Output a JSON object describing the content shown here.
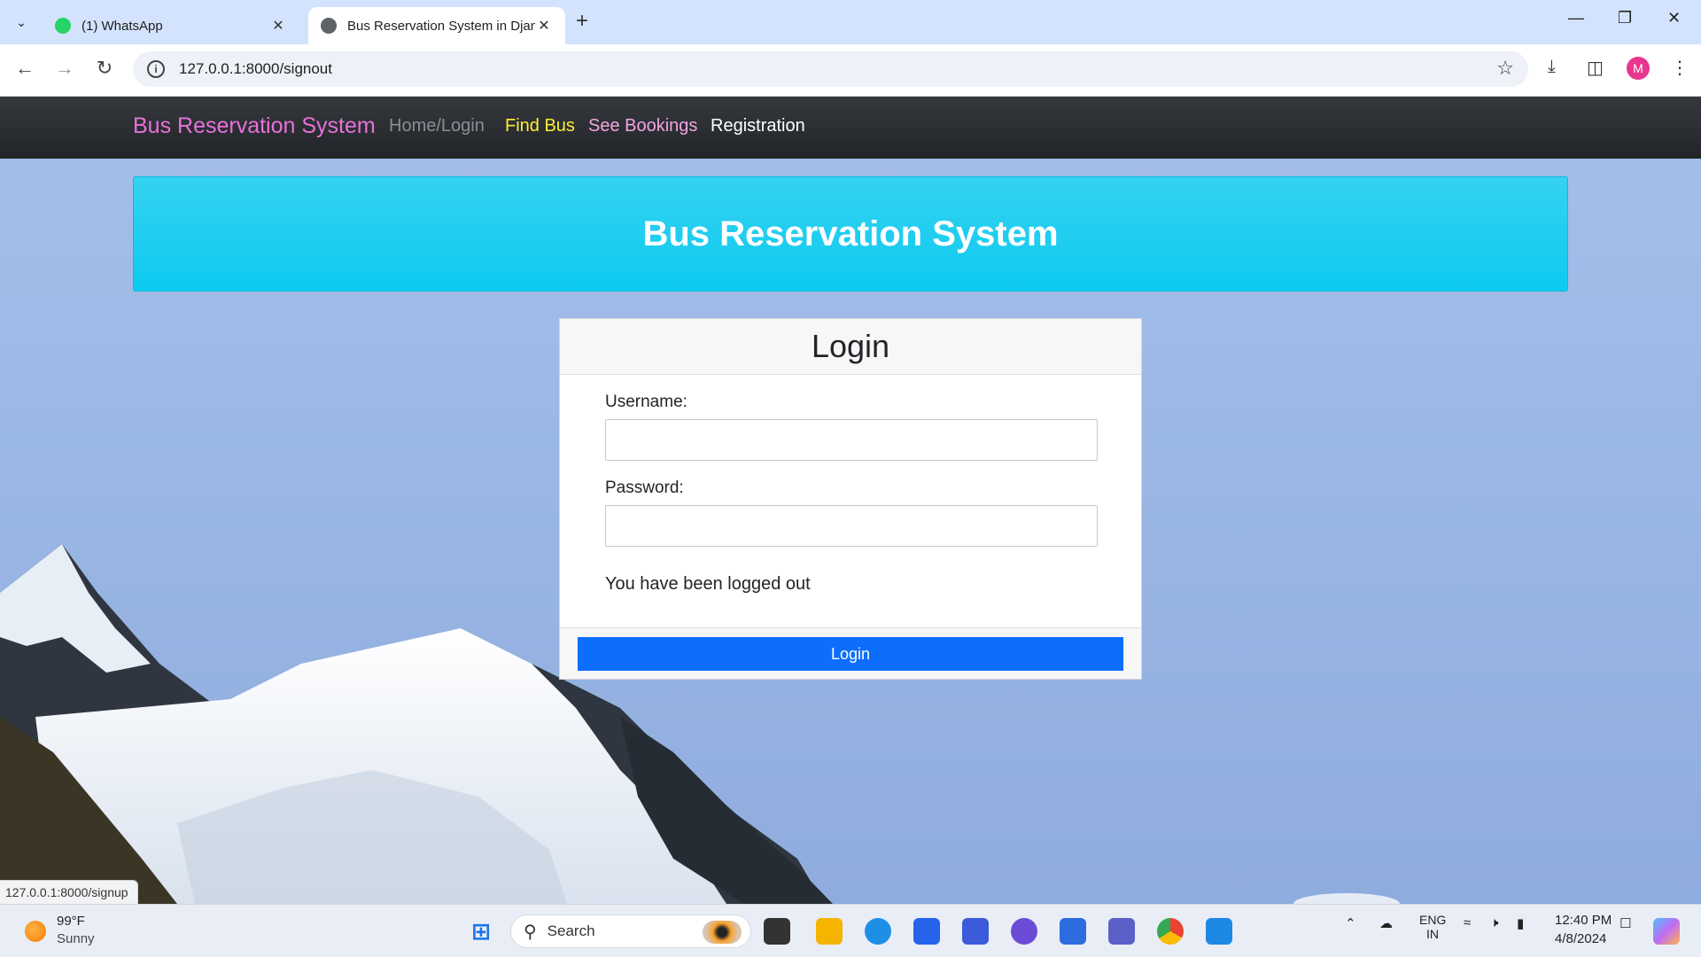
{
  "browser": {
    "tabs": [
      {
        "label": "(1) WhatsApp",
        "active": false
      },
      {
        "label": "Bus Reservation System in Djan",
        "active": true
      }
    ],
    "url": "127.0.0.1:8000/signout",
    "profile_initial": "M",
    "status_url": "127.0.0.1:8000/signup"
  },
  "navbar": {
    "brand": "Bus Reservation System",
    "links": [
      {
        "label": "Home/Login",
        "color": "#8a8f95"
      },
      {
        "label": "Find Bus",
        "color": "#ffee33"
      },
      {
        "label": "See Bookings",
        "color": "#f2a5e2"
      },
      {
        "label": "Registration",
        "color": "#ffffff"
      }
    ],
    "brand_color": "#e871d9"
  },
  "hero": {
    "title": "Bus Reservation System"
  },
  "login": {
    "title": "Login",
    "username_label": "Username:",
    "username_value": "",
    "password_label": "Password:",
    "password_value": "",
    "message": "You have been logged out",
    "button_label": "Login",
    "button_color": "#0d6efd"
  },
  "taskbar": {
    "weather": {
      "temp": "99°F",
      "condition": "Sunny"
    },
    "search_placeholder": "Search",
    "language": {
      "line1": "ENG",
      "line2": "IN"
    },
    "clock": {
      "time": "12:40 PM",
      "date": "4/8/2024"
    }
  }
}
